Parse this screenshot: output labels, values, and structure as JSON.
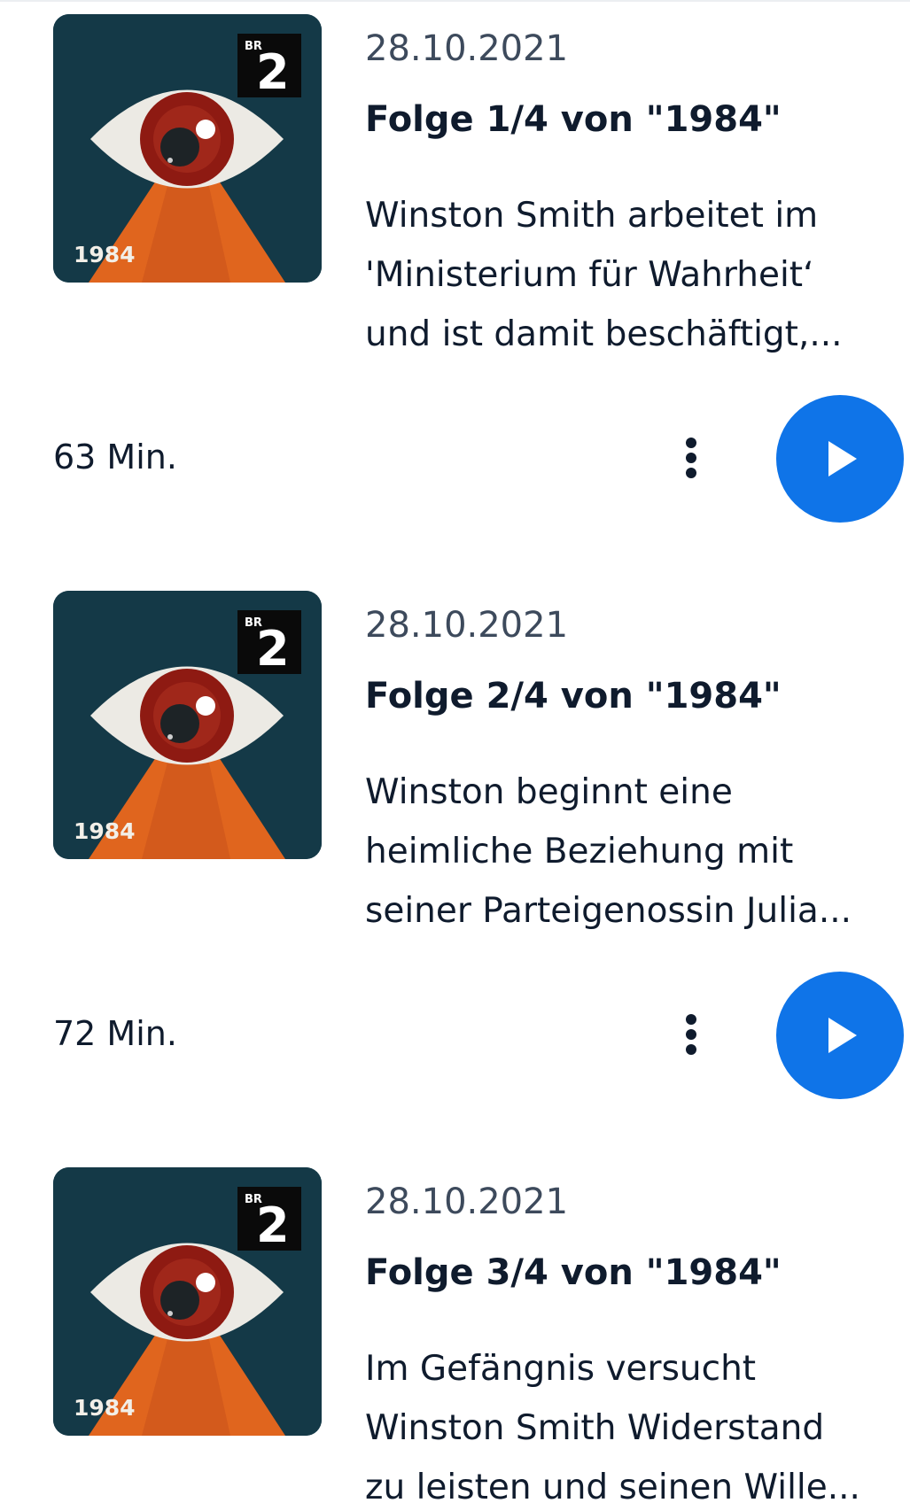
{
  "episodes": [
    {
      "cover": {
        "brand": "BR",
        "channel": "2",
        "title": "1984"
      },
      "date": "28.10.2021",
      "title": "Folge 1/4 von \"1984\"",
      "description_lines": [
        "Winston Smith arbeitet im",
        "'Ministerium für Wahrheit‘",
        "und ist damit beschäftigt,..."
      ],
      "duration": "63 Min."
    },
    {
      "cover": {
        "brand": "BR",
        "channel": "2",
        "title": "1984"
      },
      "date": "28.10.2021",
      "title": "Folge 2/4 von \"1984\"",
      "description_lines": [
        "Winston beginnt eine",
        "heimliche Beziehung mit",
        "seiner Parteigenossin Julia..."
      ],
      "duration": "72 Min."
    },
    {
      "cover": {
        "brand": "BR",
        "channel": "2",
        "title": "1984"
      },
      "date": "28.10.2021",
      "title": "Folge 3/4 von \"1984\"",
      "description_lines": [
        "Im Gefängnis versucht",
        "Winston Smith Widerstand",
        "zu leisten und seinen Wille..."
      ]
    }
  ],
  "icons": {
    "more": "more-vertical-icon",
    "play": "play-icon"
  },
  "colors": {
    "accent": "#0f74e8",
    "text": "#0f1b2d",
    "muted": "#3d4a5c",
    "cover_bg": "#173f4f",
    "cover_orange": "#e0651e",
    "cover_eye_red": "#8e1a12"
  }
}
